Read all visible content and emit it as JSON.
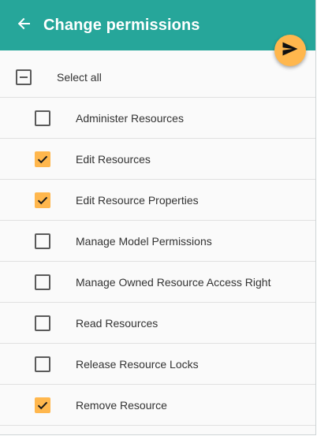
{
  "header": {
    "title": "Change permissions",
    "background": "#26a69a",
    "back_icon": "arrow-left-icon"
  },
  "send_button": {
    "icon": "send-icon",
    "color": "#ffb74d"
  },
  "select_all": {
    "label": "Select all",
    "state": "indeterminate"
  },
  "permissions": [
    {
      "label": "Administer Resources",
      "checked": false
    },
    {
      "label": "Edit Resources",
      "checked": true
    },
    {
      "label": "Edit Resource Properties",
      "checked": true
    },
    {
      "label": "Manage Model Permissions",
      "checked": false
    },
    {
      "label": "Manage Owned Resource Access Right",
      "checked": false
    },
    {
      "label": "Read Resources",
      "checked": false
    },
    {
      "label": "Release Resource Locks",
      "checked": false
    },
    {
      "label": "Remove Resource",
      "checked": true
    }
  ],
  "accent_color": "#ffb74d"
}
